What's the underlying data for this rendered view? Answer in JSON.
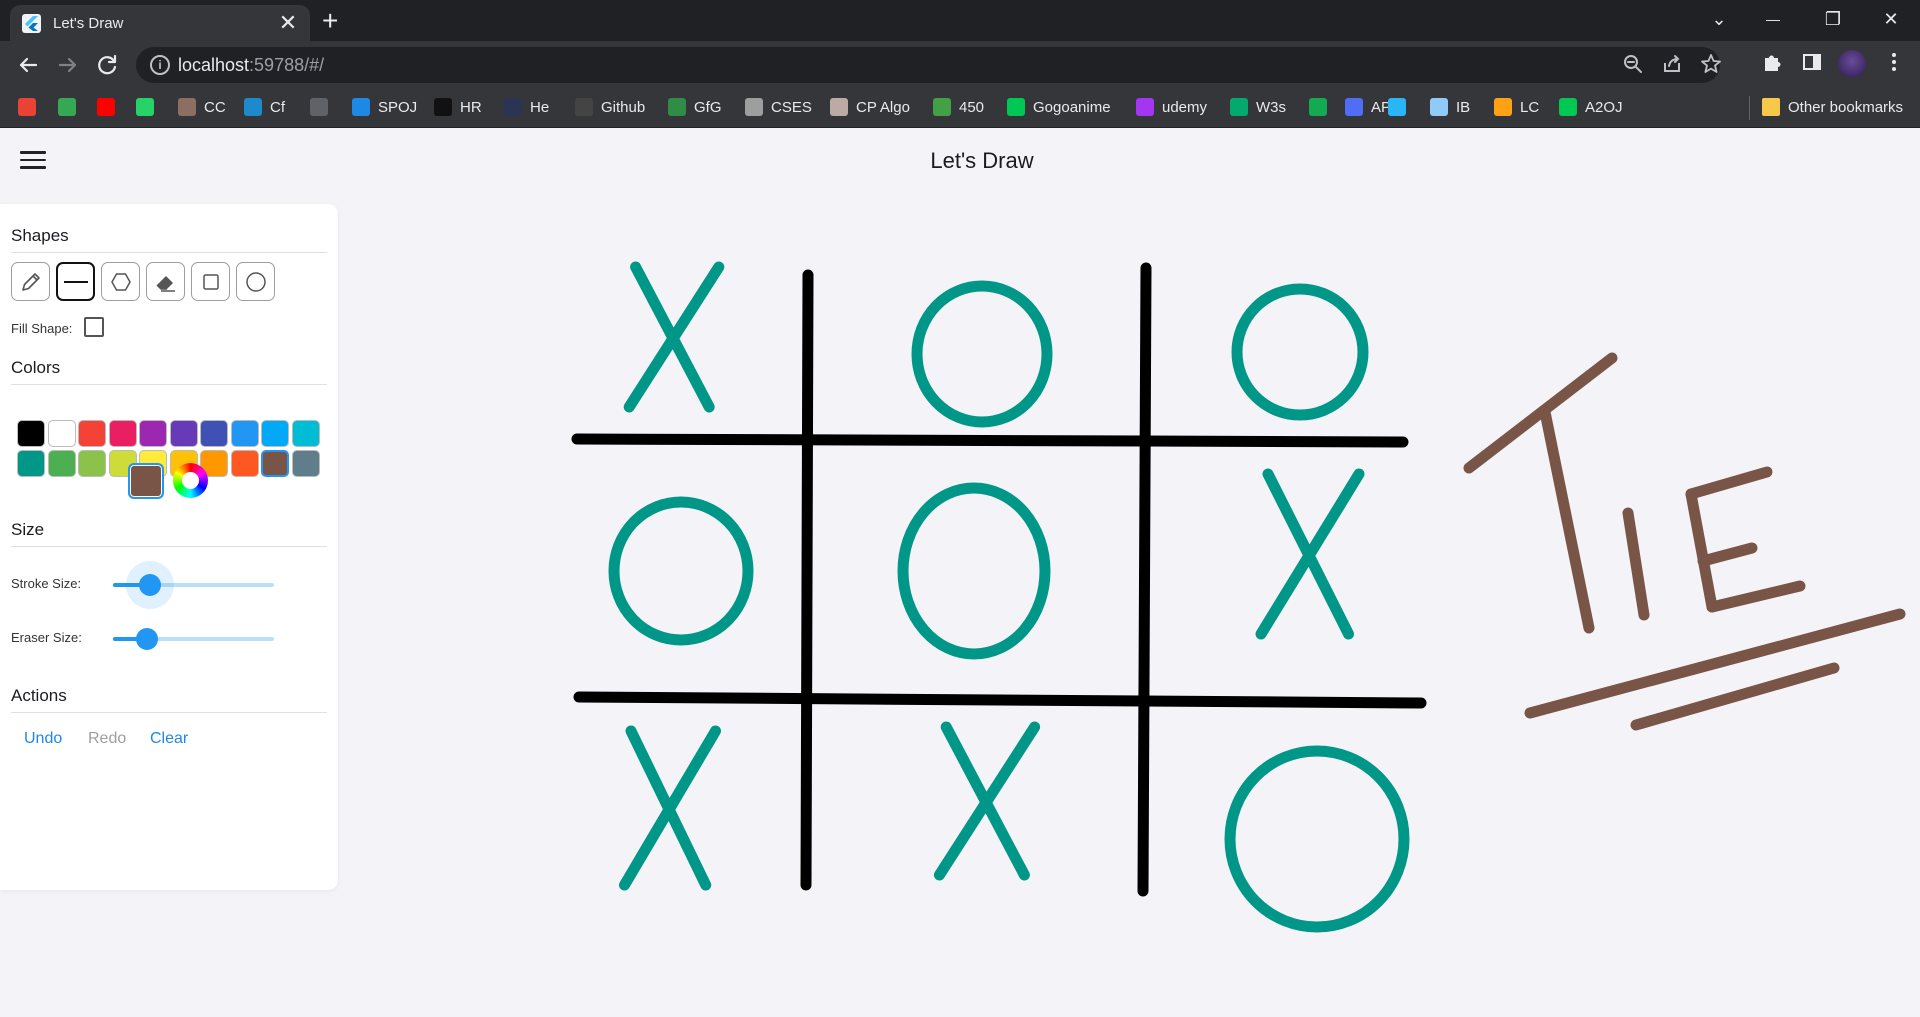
{
  "browser": {
    "tab": {
      "title": "Let's Draw",
      "close": "✕"
    },
    "new_tab": "+",
    "window": {
      "dropdown": "⌄",
      "minimize": "—",
      "restore": "❐",
      "close": "✕"
    },
    "url": {
      "host": "localhost",
      "rest": ":59788/#/"
    },
    "bookmarks": [
      {
        "label": "",
        "icon": "gmail-icon",
        "color": "#ea4335"
      },
      {
        "label": "",
        "icon": "drive-icon",
        "color": "#34a853"
      },
      {
        "label": "",
        "icon": "youtube-icon",
        "color": "#ff0000"
      },
      {
        "label": "",
        "icon": "whatsapp-icon",
        "color": "#25d366"
      },
      {
        "label": "CC",
        "icon": "cc-icon",
        "color": "#8d6e63"
      },
      {
        "label": "Cf",
        "icon": "codeforces-icon",
        "color": "#1f8acb"
      },
      {
        "label": "",
        "icon": "cfv-icon",
        "color": "#5f6368"
      },
      {
        "label": "SPOJ",
        "icon": "spoj-icon",
        "color": "#1e88e5"
      },
      {
        "label": "HR",
        "icon": "hackerrank-icon",
        "color": "#111111"
      },
      {
        "label": "He",
        "icon": "hackerearth-icon",
        "color": "#2c3454"
      },
      {
        "label": "Github",
        "icon": "github-icon",
        "color": "#444444"
      },
      {
        "label": "GfG",
        "icon": "gfg-icon",
        "color": "#2f8d46"
      },
      {
        "label": "CSES",
        "icon": "cses-icon",
        "color": "#9e9e9e"
      },
      {
        "label": "CP Algo",
        "icon": "cp-algo-icon",
        "color": "#bcaaa4"
      },
      {
        "label": "450",
        "icon": "450-icon",
        "color": "#43a047"
      },
      {
        "label": "Gogoanime",
        "icon": "gogoanime-icon",
        "color": "#00c853"
      },
      {
        "label": "udemy",
        "icon": "udemy-icon",
        "color": "#a435f0"
      },
      {
        "label": "W3s",
        "icon": "w3s-icon",
        "color": "#04aa6d"
      },
      {
        "label": "",
        "icon": "mongodb-icon",
        "color": "#13aa52"
      },
      {
        "label": "API",
        "icon": "api-icon",
        "color": "#4f6df5"
      },
      {
        "label": "",
        "icon": "azure-icon",
        "color": "#29b6f6"
      },
      {
        "label": "IB",
        "icon": "interviewbit-icon",
        "color": "#90caf9"
      },
      {
        "label": "LC",
        "icon": "leetcode-icon",
        "color": "#ffa116"
      },
      {
        "label": "A2OJ",
        "icon": "a2oj-icon",
        "color": "#00c853"
      }
    ],
    "other_bookmarks": "Other bookmarks"
  },
  "app": {
    "title": "Let's Draw",
    "panel": {
      "shapes_title": "Shapes",
      "tools": [
        {
          "name": "pencil-tool",
          "icon": "pencil-icon",
          "active": false
        },
        {
          "name": "line-tool",
          "icon": "line-icon",
          "active": true
        },
        {
          "name": "polygon-tool",
          "icon": "hexagon-icon",
          "active": false
        },
        {
          "name": "eraser-tool",
          "icon": "eraser-icon",
          "active": false
        },
        {
          "name": "square-tool",
          "icon": "square-icon",
          "active": false
        },
        {
          "name": "circle-tool",
          "icon": "circle-icon",
          "active": false
        }
      ],
      "fill_shape_label": "Fill Shape:",
      "fill_shape_checked": false,
      "colors_title": "Colors",
      "colors": [
        "#000000",
        "#ffffff",
        "#f44336",
        "#e91e63",
        "#9c27b0",
        "#673ab7",
        "#3f51b5",
        "#2196f3",
        "#03a9f4",
        "#00bcd4",
        "#009688",
        "#4caf50",
        "#8bc34a",
        "#cddc39",
        "#ffeb3b",
        "#ffc107",
        "#ff9800",
        "#ff5722",
        "#795548",
        "#607d8b"
      ],
      "selected_color": "#795548",
      "size_title": "Size",
      "stroke_size_label": "Stroke Size:",
      "stroke_size_fraction": 0.23,
      "eraser_size_label": "Eraser Size:",
      "eraser_size_fraction": 0.21,
      "actions_title": "Actions",
      "undo_label": "Undo",
      "redo_label": "Redo",
      "clear_label": "Clear"
    },
    "canvas": {
      "board_color": "#000000",
      "piece_color": "#009688",
      "text_color": "#795548",
      "cells": [
        "X",
        "O",
        "O",
        "O",
        "O",
        "X",
        "X",
        "X",
        "O"
      ],
      "handwriting": "TIE"
    }
  }
}
